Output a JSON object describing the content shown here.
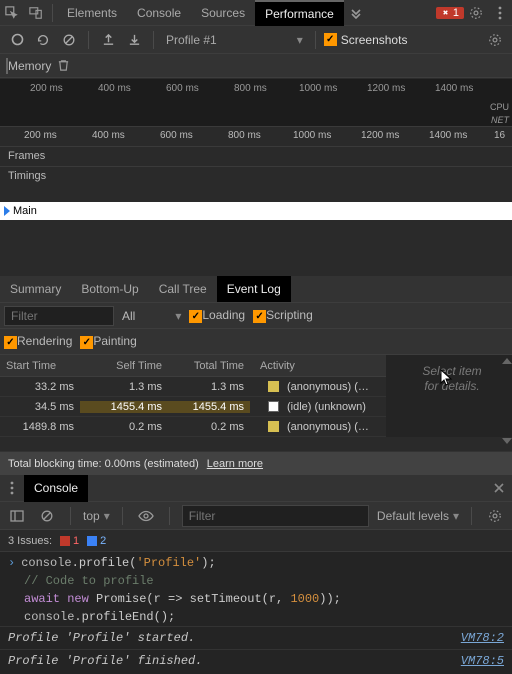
{
  "tabs": {
    "elements": "Elements",
    "console": "Console",
    "sources": "Sources",
    "performance": "Performance"
  },
  "error_badge": "1",
  "toolbar": {
    "profile_name": "Profile #1",
    "screenshots": "Screenshots",
    "memory": "Memory"
  },
  "ruler_overview": [
    "200 ms",
    "400 ms",
    "600 ms",
    "800 ms",
    "1000 ms",
    "1200 ms",
    "1400 ms"
  ],
  "cpu_label": "CPU",
  "net_label": "NET",
  "ruler_detail": [
    "200 ms",
    "400 ms",
    "600 ms",
    "800 ms",
    "1000 ms",
    "1200 ms",
    "1400 ms",
    "16"
  ],
  "tracks": {
    "frames": "Frames",
    "timings": "Timings",
    "main": "Main"
  },
  "subtabs": {
    "summary": "Summary",
    "bottomup": "Bottom-Up",
    "calltree": "Call Tree",
    "eventlog": "Event Log"
  },
  "filter": {
    "placeholder": "Filter",
    "all": "All",
    "loading": "Loading",
    "scripting": "Scripting",
    "rendering": "Rendering",
    "painting": "Painting"
  },
  "table": {
    "headers": {
      "start": "Start Time",
      "self": "Self Time",
      "total": "Total Time",
      "activity": "Activity"
    },
    "rows": [
      {
        "start": "33.2 ms",
        "self": "1.3 ms",
        "total": "1.3 ms",
        "swatch": "y",
        "activity": "(anonymous)  (…"
      },
      {
        "start": "34.5 ms",
        "self": "1455.4 ms",
        "total": "1455.4 ms",
        "swatch": "w",
        "activity": "(idle)  (unknown)"
      },
      {
        "start": "1489.8 ms",
        "self": "0.2 ms",
        "total": "0.2 ms",
        "swatch": "y",
        "activity": "(anonymous)  (…"
      }
    ]
  },
  "details_placeholder_l1": "Select item",
  "details_placeholder_l2": "for details.",
  "tbt": {
    "text": "Total blocking time: 0.00ms (estimated)",
    "learn_more": "Learn more"
  },
  "drawer": {
    "console_tab": "Console",
    "context": "top",
    "filter_placeholder": "Filter",
    "levels": "Default levels"
  },
  "issues": {
    "label": "3 Issues:",
    "red": "1",
    "blue": "2"
  },
  "console_lines": {
    "l1a": "console",
    "l1b": ".profile(",
    "l1c": "'Profile'",
    "l1d": ");",
    "l2": "// Code to profile",
    "l3a": "await new",
    "l3b": " Promise(r => setTimeout(r, ",
    "l3c": "1000",
    "l3d": "));",
    "l4a": "console",
    "l4b": ".profileEnd();"
  },
  "log1": {
    "text": "Profile 'Profile' started.",
    "link": "VM78:2"
  },
  "log2": {
    "text": "Profile 'Profile' finished.",
    "link": "VM78:5"
  }
}
